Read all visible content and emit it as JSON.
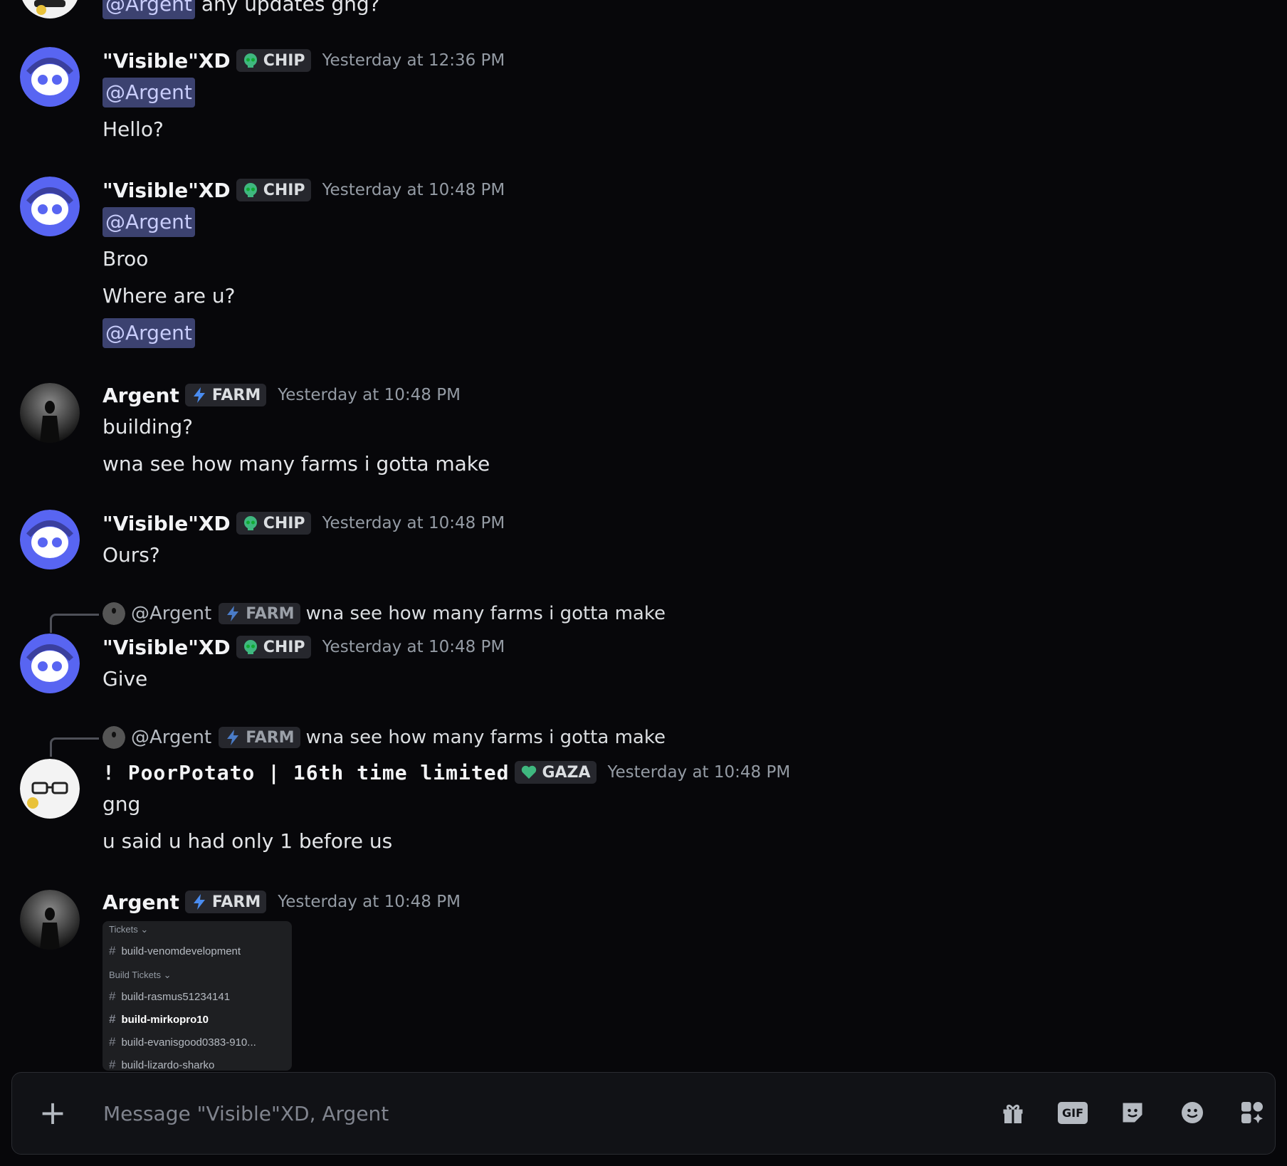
{
  "messages": {
    "m0": {
      "mention": "@Argent",
      "text": "any updates gng?"
    },
    "m1": {
      "user": "\"Visible\"XD",
      "tag": "CHIP",
      "time": "Yesterday at 12:36 PM",
      "lines": [
        "@Argent",
        "Hello?"
      ]
    },
    "m2": {
      "user": "\"Visible\"XD",
      "tag": "CHIP",
      "time": "Yesterday at 10:48 PM",
      "lines": [
        "@Argent",
        "Broo",
        "Where are u?",
        "@Argent"
      ]
    },
    "m3": {
      "user": "Argent",
      "tag": "FARM",
      "time": "Yesterday at 10:48 PM",
      "lines": [
        "building?",
        "wna see how many farms i gotta make"
      ]
    },
    "m4": {
      "user": "\"Visible\"XD",
      "tag": "CHIP",
      "time": "Yesterday at 10:48 PM",
      "lines": [
        "Ours?"
      ]
    },
    "m5": {
      "reply_user": "@Argent",
      "reply_tag": "FARM",
      "reply_text": "wna see how many farms i gotta make",
      "user": "\"Visible\"XD",
      "tag": "CHIP",
      "time": "Yesterday at 10:48 PM",
      "lines": [
        "Give"
      ]
    },
    "m6": {
      "reply_user": "@Argent",
      "reply_tag": "FARM",
      "reply_text": "wna see how many farms i gotta make",
      "user": "! PoorPotato | 16th time limited",
      "tag": "GAZA",
      "time": "Yesterday at 10:48 PM",
      "lines": [
        "gng",
        "u said u had only 1 before us"
      ]
    },
    "m7": {
      "user": "Argent",
      "tag": "FARM",
      "time": "Yesterday at 10:48 PM"
    }
  },
  "attachment": {
    "category1": "Tickets",
    "category2": "Build Tickets",
    "channels": [
      "build-venomdevelopment",
      "build-rasmus51234141",
      "build-mirkopro10",
      "build-evanisgood0383-910...",
      "build-lizardo-sharko"
    ]
  },
  "composer": {
    "placeholder": "Message \"Visible\"XD, Argent"
  },
  "icons": {
    "plus": "+",
    "gif": "GIF",
    "chip": "skull-icon",
    "farm": "lightning-icon",
    "gaza": "heart-icon"
  }
}
